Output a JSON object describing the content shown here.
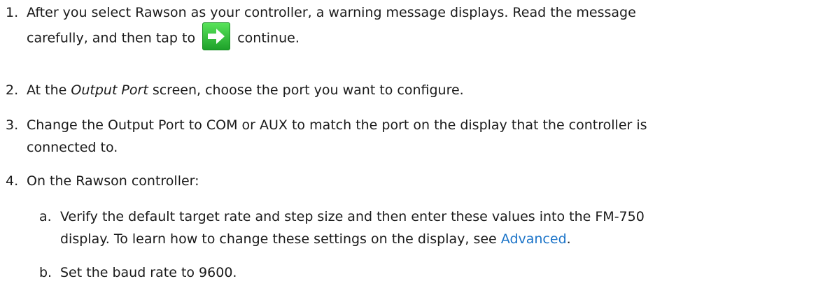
{
  "steps": [
    {
      "number": "1.",
      "line1": "After you select Rawson as your controller, a warning message displays. Read the message",
      "line2_before": "carefully, and then tap to",
      "icon": "arrow-right-icon",
      "line2_after": "continue."
    },
    {
      "number": "2.",
      "before": "At the",
      "emphasis": "Output Port",
      "after": "screen, choose the port you want to configure."
    },
    {
      "number": "3.",
      "line1": "Change the Output Port to COM or AUX to match the port on the display that the controller is",
      "line2": "connected to."
    },
    {
      "number": "4.",
      "text": "On the Rawson controller:"
    }
  ],
  "substeps": [
    {
      "letter": "a.",
      "line1": "Verify the default target rate and step size and then enter these values into the FM-750",
      "line2_before": "display. To learn how to change these settings on the display, see",
      "link": "Advanced",
      "line2_after": "."
    },
    {
      "letter": "b.",
      "text": "Set the baud rate to 9600."
    }
  ],
  "colors": {
    "link": "#1a73c8",
    "icon_green": "#2cb634"
  }
}
